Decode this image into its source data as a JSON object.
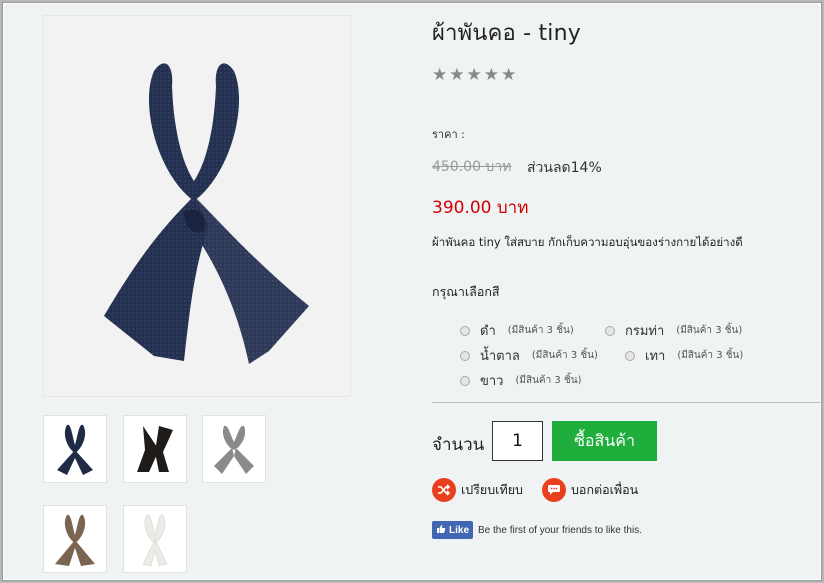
{
  "product": {
    "title": "ผ้าพันคอ - tiny",
    "stars": "★★★★★",
    "price_label": "ราคา :",
    "old_price": "450.00 บาท",
    "discount": "ส่วนลด14%",
    "new_price": "390.00 บาท",
    "description": "ผ้าพันคอ tiny ใส่สบาย กักเก็บความอบอุ่นของร่างกายได้อย่างดี"
  },
  "color_select": {
    "label": "กรุณาเลือกสี",
    "options": [
      {
        "name": "ดำ",
        "stock": "(มีสินค้า 3 ชิ้น)"
      },
      {
        "name": "กรมท่า",
        "stock": "(มีสินค้า 3 ชิ้น)"
      },
      {
        "name": "น้ำตาล",
        "stock": "(มีสินค้า 3 ชิ้น)"
      },
      {
        "name": "เทา",
        "stock": "(มีสินค้า 3 ชิ้น)"
      },
      {
        "name": "ขาว",
        "stock": "(มีสินค้า 3 ชิ้น)"
      }
    ]
  },
  "purchase": {
    "qty_label": "จำนวน",
    "qty_value": "1",
    "buy_label": "ซื้อสินค้า"
  },
  "actions": {
    "compare": "เปรียบเทียบ",
    "share": "บอกต่อเพื่อน"
  },
  "facebook": {
    "like_label": "Like",
    "like_text": "Be the first of your friends to like this."
  },
  "thumbnails": [
    {
      "color": "#1f2a44"
    },
    {
      "color": "#1e1b19"
    },
    {
      "color": "#8a8a8a"
    },
    {
      "color": "#7a6553"
    },
    {
      "color": "#ecebe6"
    }
  ],
  "icons": {
    "stars": "star-icon",
    "compare": "shuffle-icon",
    "share": "chat-bubble-icon",
    "facebook": "thumbs-up-icon"
  }
}
